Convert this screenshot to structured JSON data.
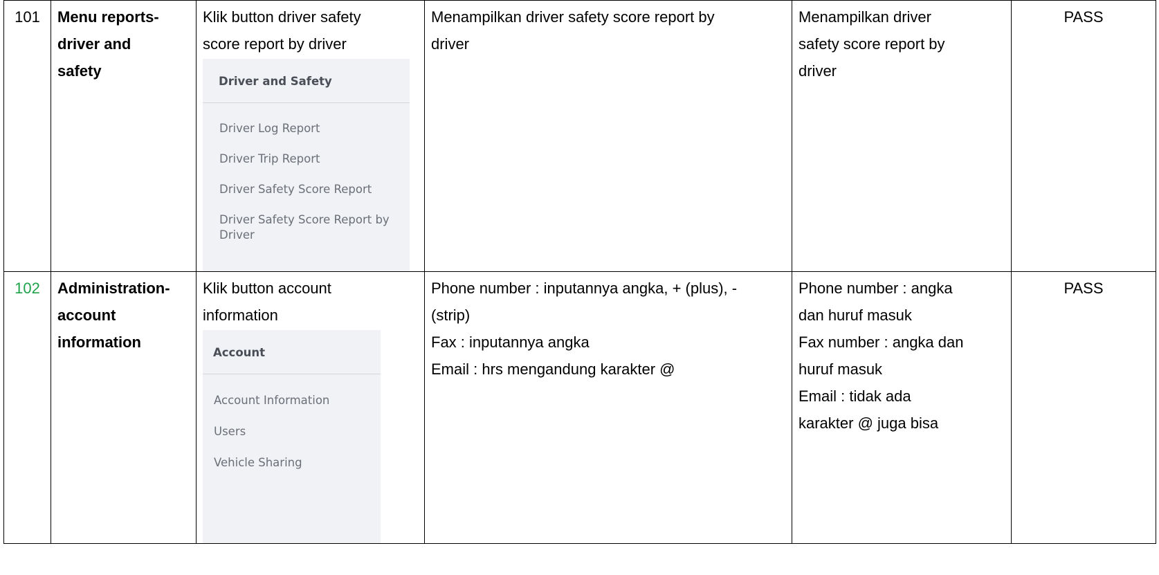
{
  "rows": [
    {
      "no": "101",
      "feature": [
        "Menu reports-",
        "driver and",
        "safety"
      ],
      "steps": [
        "Klik button driver safety",
        "score report by driver"
      ],
      "menu": {
        "title": "Driver and Safety",
        "items": [
          "Driver Log Report",
          "Driver Trip Report",
          "Driver Safety Score Report",
          "Driver Safety Score Report by Driver"
        ]
      },
      "expected": [
        "Menampilkan driver safety score report by",
        "driver"
      ],
      "actual": [
        "Menampilkan driver",
        "safety score report by",
        "driver"
      ],
      "status": "PASS"
    },
    {
      "no": "102",
      "no_color": "#1fa34a",
      "feature": [
        "Administration-",
        "account",
        "information"
      ],
      "steps": [
        "Klik button account",
        "information"
      ],
      "menu": {
        "title": "Account",
        "items": [
          "Account Information",
          "Users",
          "Vehicle Sharing"
        ]
      },
      "expected": [
        "Phone number : inputannya angka, + (plus), -",
        "(strip)",
        "Fax : inputannya angka",
        "Email : hrs mengandung karakter @"
      ],
      "actual": [
        "Phone number : angka",
        "dan huruf masuk",
        "Fax number : angka dan",
        "huruf masuk",
        "Email : tidak ada",
        "karakter @ juga bisa"
      ],
      "status": "PASS"
    }
  ]
}
